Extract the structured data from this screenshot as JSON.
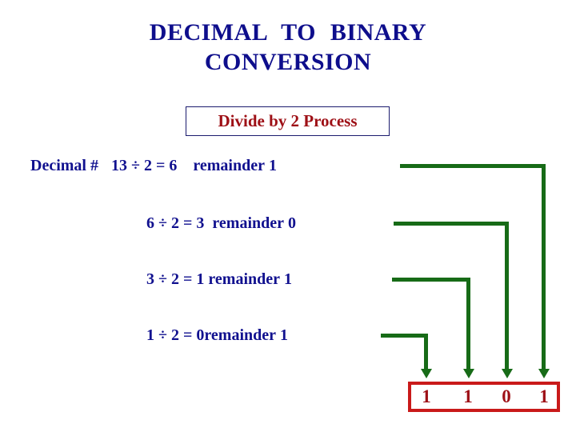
{
  "title": {
    "line1": "DECIMAL  TO  BINARY",
    "line2": "CONVERSION",
    "color": "#0e0e8c"
  },
  "subtitle": {
    "label": "Divide by 2 Process",
    "text_color": "#9e1016",
    "border_color": "#1b1b6e"
  },
  "steps": [
    {
      "prefix": "Decimal #",
      "dividend": "13",
      "op": "÷",
      "divisor": "2",
      "eq": "=",
      "quotient": "6",
      "remainder_label": "remainder",
      "remainder": "1"
    },
    {
      "prefix": "",
      "dividend": "6",
      "op": "÷",
      "divisor": "2",
      "eq": "=",
      "quotient": "3",
      "remainder_label": "remainder",
      "remainder": "0"
    },
    {
      "prefix": "",
      "dividend": "3",
      "op": "÷",
      "divisor": "2",
      "eq": "=",
      "quotient": "1",
      "remainder_label": "remainder",
      "remainder": "1"
    },
    {
      "prefix": "",
      "dividend": "1",
      "op": "÷",
      "divisor": "2",
      "eq": "=",
      "quotient": "0",
      "remainder_label": "remainder",
      "remainder": "1"
    }
  ],
  "connectors": {
    "color": "#176b17",
    "paths": [
      {
        "from_step": 1,
        "to_digit": 4
      },
      {
        "from_step": 2,
        "to_digit": 3
      },
      {
        "from_step": 3,
        "to_digit": 2
      },
      {
        "from_step": 4,
        "to_digit": 1
      }
    ]
  },
  "result": {
    "digits": [
      "1",
      "1",
      "0",
      "1"
    ],
    "text_color": "#9e1016",
    "border_color": "#c91a1a"
  }
}
